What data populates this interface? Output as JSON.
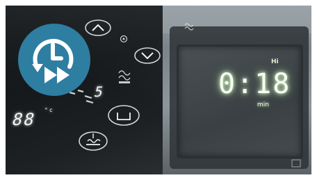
{
  "badge": {
    "icon": "clock-fast-forward-icon",
    "color": "#2e7ea1"
  },
  "control_panel": {
    "segment_display_left": "88",
    "segment_display_center": "5",
    "superscript_unit": "°c",
    "buttons": [
      "up-arrow-button",
      "down-arrow-button",
      "select-button",
      "bake-mode-button"
    ]
  },
  "oven_display": {
    "value": "0:18",
    "unit": "min",
    "level": "Hi"
  }
}
